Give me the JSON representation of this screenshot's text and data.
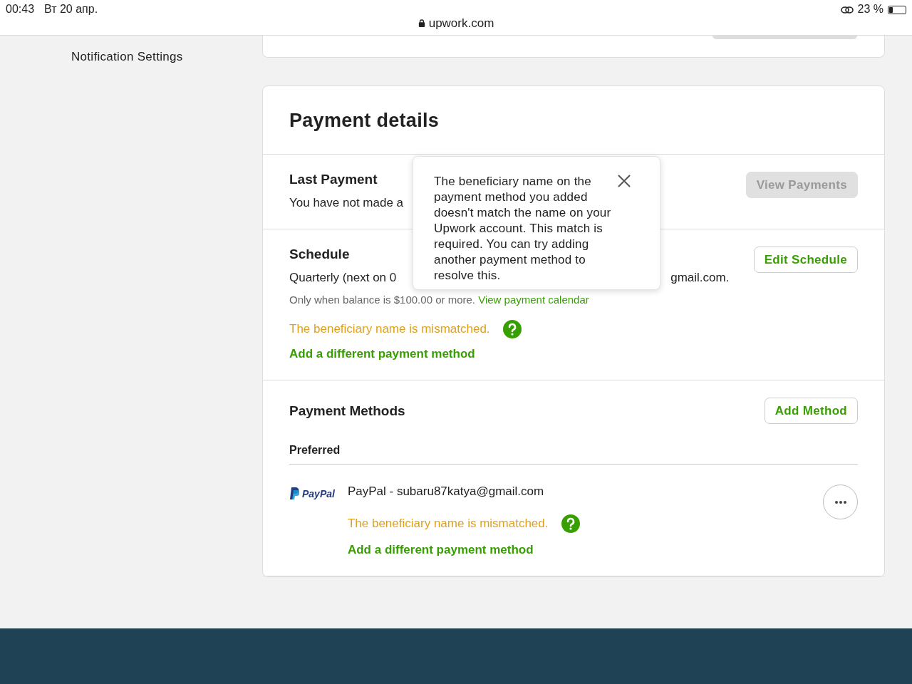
{
  "status_bar": {
    "time": "00:43",
    "date": "Вт 20 апр.",
    "url": "upwork.com",
    "battery": "23 %"
  },
  "sidebar": {
    "items": [
      {
        "label": "Notification Settings"
      }
    ]
  },
  "payment_details": {
    "title": "Payment details",
    "last_payment": {
      "title": "Last Payment",
      "text": "You have not made a",
      "button": {
        "label": "View Payments",
        "disabled": true
      }
    },
    "schedule": {
      "title": "Schedule",
      "text_left": "Quarterly (next on 0",
      "text_right": "gmail.com.",
      "note": "Only when balance is $100.00 or more.",
      "note_link": "View payment calendar",
      "warning": "The beneficiary name is mismatched.",
      "action_link": "Add a different payment method",
      "button": {
        "label": "Edit Schedule",
        "disabled": false
      }
    },
    "payment_methods": {
      "title": "Payment Methods",
      "button": {
        "label": "Add Method",
        "disabled": false
      },
      "group_label": "Preferred",
      "methods": [
        {
          "kind": "paypal",
          "brand": "PayPal",
          "name": "PayPal - subaru87katya@gmail.com",
          "warning": "The beneficiary name is mismatched.",
          "action_link": "Add a different payment method"
        }
      ]
    }
  },
  "popover": {
    "text": "The beneficiary name on the payment method you added doesn't match the name on your Upwork account. This match is required. You can try adding another payment method to resolve this."
  }
}
